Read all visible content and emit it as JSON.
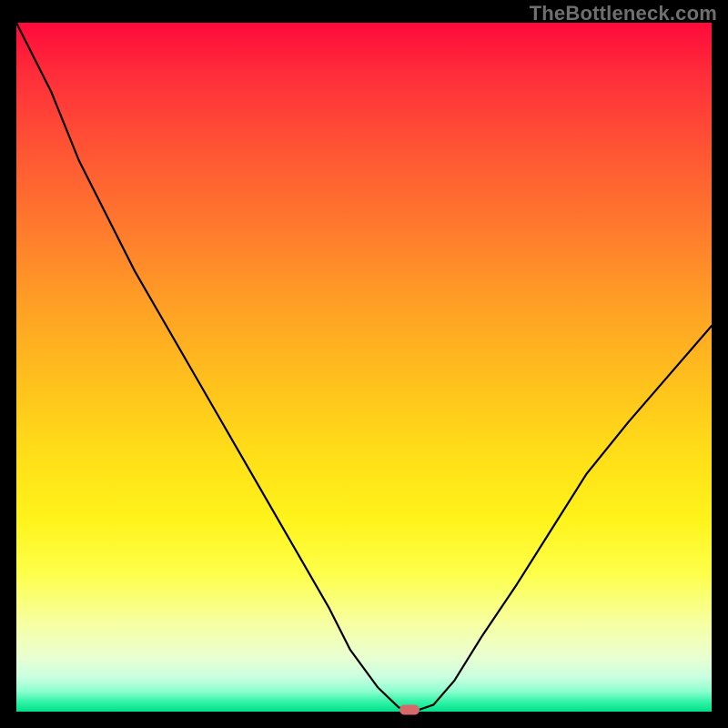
{
  "watermark": "TheBottleneck.com",
  "colors": {
    "page_bg": "#000000",
    "curve_stroke": "#000000",
    "marker_fill": "#d66a6a",
    "watermark_text": "#6f6f6f"
  },
  "chart_data": {
    "type": "line",
    "title": "",
    "xlabel": "",
    "ylabel": "",
    "x": [
      0.0,
      0.05,
      0.09,
      0.14,
      0.17,
      0.21,
      0.25,
      0.29,
      0.33,
      0.37,
      0.41,
      0.45,
      0.48,
      0.52,
      0.55,
      0.56,
      0.58,
      0.6,
      0.63,
      0.67,
      0.72,
      0.77,
      0.82,
      0.88,
      0.94,
      1.0
    ],
    "values": [
      1.0,
      0.9,
      0.8,
      0.7,
      0.64,
      0.57,
      0.5,
      0.43,
      0.36,
      0.29,
      0.22,
      0.15,
      0.09,
      0.035,
      0.006,
      0.003,
      0.003,
      0.01,
      0.045,
      0.11,
      0.185,
      0.265,
      0.345,
      0.42,
      0.49,
      0.56
    ],
    "xlim": [
      0,
      1
    ],
    "ylim": [
      0,
      1
    ],
    "grid": false,
    "gradient_colors_top_to_bottom": [
      "#ff0a3b",
      "#ff5a33",
      "#ffa324",
      "#ffdf18",
      "#fdff4a",
      "#eaffd1",
      "#00e189"
    ],
    "marker": {
      "x": 0.565,
      "y": 0.003
    }
  }
}
